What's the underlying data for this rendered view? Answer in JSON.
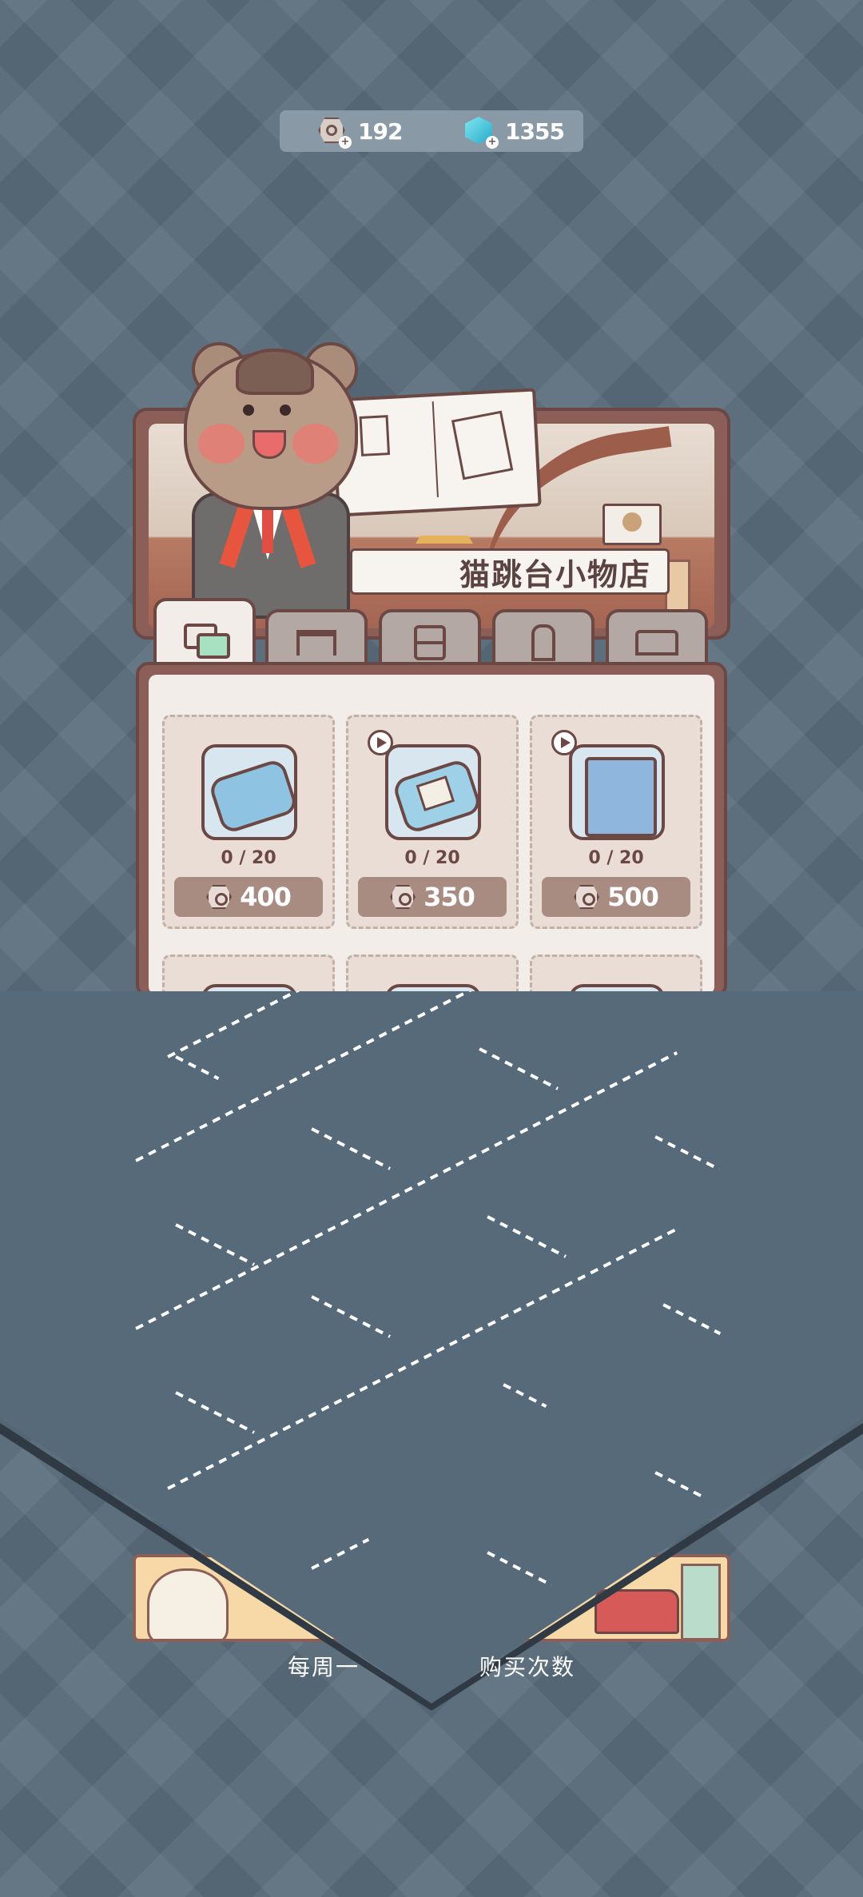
{
  "currency": {
    "coins": "192",
    "gems": "1355",
    "coin_icon": "coin-hex-icon",
    "gem_icon": "gem-hex-icon"
  },
  "shop": {
    "name": "猫跳台小物店"
  },
  "tabs": [
    {
      "id": "decor",
      "icon": "cards-icon",
      "active": true
    },
    {
      "id": "table",
      "icon": "table-icon",
      "active": false
    },
    {
      "id": "cabinet",
      "icon": "cabinet-icon",
      "active": false
    },
    {
      "id": "chair",
      "icon": "chair-icon",
      "active": false
    },
    {
      "id": "bed",
      "icon": "bed-icon",
      "active": false
    }
  ],
  "items": [
    {
      "stock": "0 / 20",
      "price": "400",
      "ad_badge": false,
      "icon": "bathtub-icon"
    },
    {
      "stock": "0 / 20",
      "price": "350",
      "ad_badge": true,
      "icon": "pillow-bed-icon"
    },
    {
      "stock": "0 / 20",
      "price": "500",
      "ad_badge": true,
      "icon": "curtain-bed-icon"
    }
  ],
  "footer": {
    "refresh_text": "每周一",
    "refresh_text_tail": "购买次数"
  },
  "colors": {
    "background": "#5a6d7c",
    "panel_brown": "#8b5f57",
    "outline": "#6b4844",
    "button": "#a88b81"
  }
}
